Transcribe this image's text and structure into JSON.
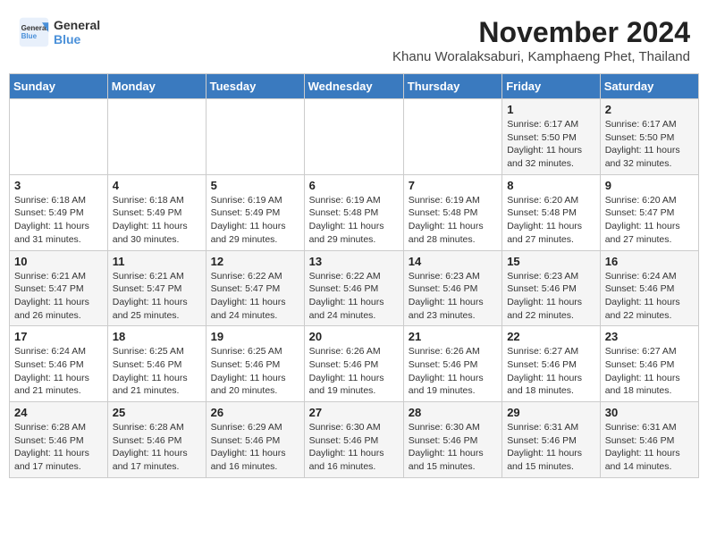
{
  "logo": {
    "line1": "General",
    "line2": "Blue"
  },
  "title": "November 2024",
  "subtitle": "Khanu Woralaksaburi, Kamphaeng Phet, Thailand",
  "weekdays": [
    "Sunday",
    "Monday",
    "Tuesday",
    "Wednesday",
    "Thursday",
    "Friday",
    "Saturday"
  ],
  "weeks": [
    [
      {
        "day": "",
        "info": ""
      },
      {
        "day": "",
        "info": ""
      },
      {
        "day": "",
        "info": ""
      },
      {
        "day": "",
        "info": ""
      },
      {
        "day": "",
        "info": ""
      },
      {
        "day": "1",
        "info": "Sunrise: 6:17 AM\nSunset: 5:50 PM\nDaylight: 11 hours and 32 minutes."
      },
      {
        "day": "2",
        "info": "Sunrise: 6:17 AM\nSunset: 5:50 PM\nDaylight: 11 hours and 32 minutes."
      }
    ],
    [
      {
        "day": "3",
        "info": "Sunrise: 6:18 AM\nSunset: 5:49 PM\nDaylight: 11 hours and 31 minutes."
      },
      {
        "day": "4",
        "info": "Sunrise: 6:18 AM\nSunset: 5:49 PM\nDaylight: 11 hours and 30 minutes."
      },
      {
        "day": "5",
        "info": "Sunrise: 6:19 AM\nSunset: 5:49 PM\nDaylight: 11 hours and 29 minutes."
      },
      {
        "day": "6",
        "info": "Sunrise: 6:19 AM\nSunset: 5:48 PM\nDaylight: 11 hours and 29 minutes."
      },
      {
        "day": "7",
        "info": "Sunrise: 6:19 AM\nSunset: 5:48 PM\nDaylight: 11 hours and 28 minutes."
      },
      {
        "day": "8",
        "info": "Sunrise: 6:20 AM\nSunset: 5:48 PM\nDaylight: 11 hours and 27 minutes."
      },
      {
        "day": "9",
        "info": "Sunrise: 6:20 AM\nSunset: 5:47 PM\nDaylight: 11 hours and 27 minutes."
      }
    ],
    [
      {
        "day": "10",
        "info": "Sunrise: 6:21 AM\nSunset: 5:47 PM\nDaylight: 11 hours and 26 minutes."
      },
      {
        "day": "11",
        "info": "Sunrise: 6:21 AM\nSunset: 5:47 PM\nDaylight: 11 hours and 25 minutes."
      },
      {
        "day": "12",
        "info": "Sunrise: 6:22 AM\nSunset: 5:47 PM\nDaylight: 11 hours and 24 minutes."
      },
      {
        "day": "13",
        "info": "Sunrise: 6:22 AM\nSunset: 5:46 PM\nDaylight: 11 hours and 24 minutes."
      },
      {
        "day": "14",
        "info": "Sunrise: 6:23 AM\nSunset: 5:46 PM\nDaylight: 11 hours and 23 minutes."
      },
      {
        "day": "15",
        "info": "Sunrise: 6:23 AM\nSunset: 5:46 PM\nDaylight: 11 hours and 22 minutes."
      },
      {
        "day": "16",
        "info": "Sunrise: 6:24 AM\nSunset: 5:46 PM\nDaylight: 11 hours and 22 minutes."
      }
    ],
    [
      {
        "day": "17",
        "info": "Sunrise: 6:24 AM\nSunset: 5:46 PM\nDaylight: 11 hours and 21 minutes."
      },
      {
        "day": "18",
        "info": "Sunrise: 6:25 AM\nSunset: 5:46 PM\nDaylight: 11 hours and 21 minutes."
      },
      {
        "day": "19",
        "info": "Sunrise: 6:25 AM\nSunset: 5:46 PM\nDaylight: 11 hours and 20 minutes."
      },
      {
        "day": "20",
        "info": "Sunrise: 6:26 AM\nSunset: 5:46 PM\nDaylight: 11 hours and 19 minutes."
      },
      {
        "day": "21",
        "info": "Sunrise: 6:26 AM\nSunset: 5:46 PM\nDaylight: 11 hours and 19 minutes."
      },
      {
        "day": "22",
        "info": "Sunrise: 6:27 AM\nSunset: 5:46 PM\nDaylight: 11 hours and 18 minutes."
      },
      {
        "day": "23",
        "info": "Sunrise: 6:27 AM\nSunset: 5:46 PM\nDaylight: 11 hours and 18 minutes."
      }
    ],
    [
      {
        "day": "24",
        "info": "Sunrise: 6:28 AM\nSunset: 5:46 PM\nDaylight: 11 hours and 17 minutes."
      },
      {
        "day": "25",
        "info": "Sunrise: 6:28 AM\nSunset: 5:46 PM\nDaylight: 11 hours and 17 minutes."
      },
      {
        "day": "26",
        "info": "Sunrise: 6:29 AM\nSunset: 5:46 PM\nDaylight: 11 hours and 16 minutes."
      },
      {
        "day": "27",
        "info": "Sunrise: 6:30 AM\nSunset: 5:46 PM\nDaylight: 11 hours and 16 minutes."
      },
      {
        "day": "28",
        "info": "Sunrise: 6:30 AM\nSunset: 5:46 PM\nDaylight: 11 hours and 15 minutes."
      },
      {
        "day": "29",
        "info": "Sunrise: 6:31 AM\nSunset: 5:46 PM\nDaylight: 11 hours and 15 minutes."
      },
      {
        "day": "30",
        "info": "Sunrise: 6:31 AM\nSunset: 5:46 PM\nDaylight: 11 hours and 14 minutes."
      }
    ]
  ]
}
